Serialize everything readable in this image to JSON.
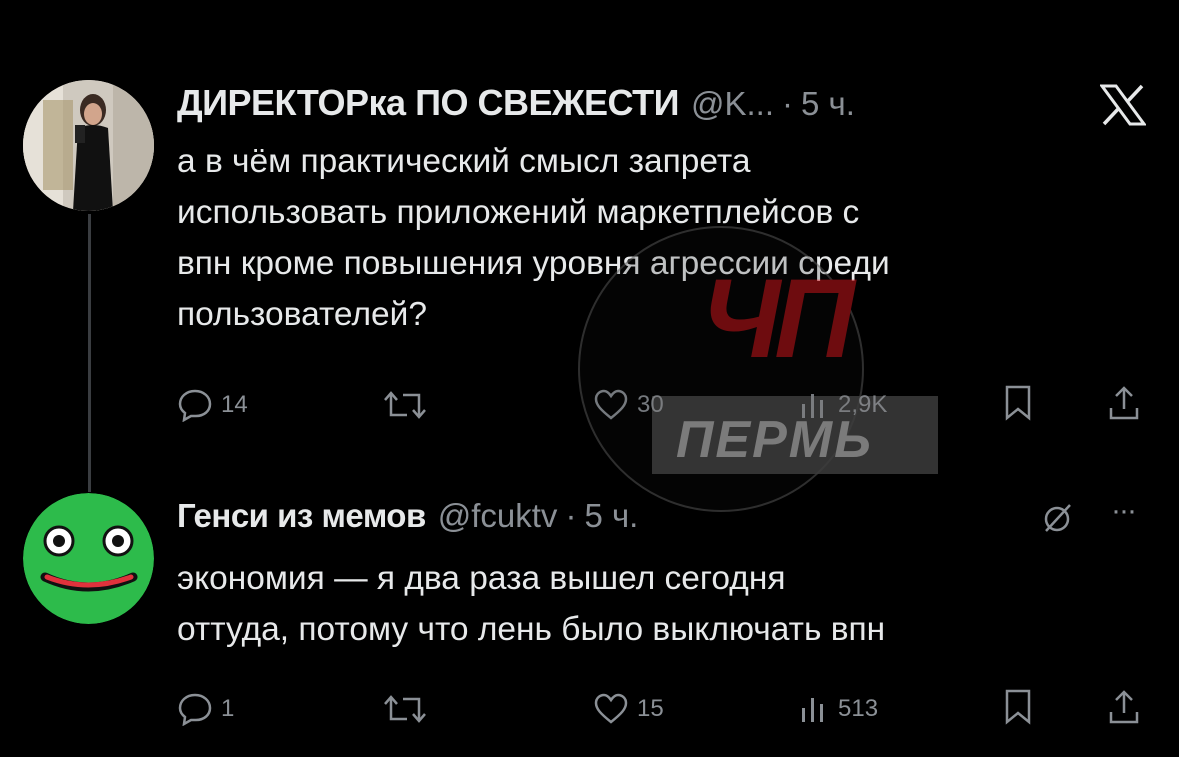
{
  "colors": {
    "background": "#000000",
    "text": "#e7e9ea",
    "muted": "#8b9096",
    "watermark_red": "#c8161d",
    "avatar2_green": "#2dbb4b"
  },
  "tweet1": {
    "author_name": "ДИРЕКТОРка ПО СВЕЖЕСТИ",
    "handle": "@K...",
    "separator": "·",
    "time": "5 ч.",
    "text_lines": [
      "а в чём практический смысл запрета",
      "использовать приложений маркетплейсов с",
      "впн кроме повышения уровня агрессии среди",
      "пользователей?"
    ],
    "actions": {
      "replies": "14",
      "reposts": "",
      "likes": "30",
      "views": "2,9K"
    },
    "icons": [
      "reply-icon",
      "repost-icon",
      "like-icon",
      "views-icon",
      "bookmark-icon",
      "share-icon"
    ]
  },
  "tweet2": {
    "author_name": "Генси из мемов",
    "handle": "@fcuktv",
    "separator": "·",
    "time": "5 ч.",
    "text_lines": [
      "экономия — я два раза вышел сегодня",
      "оттуда, потому что лень было выключать впн"
    ],
    "actions": {
      "replies": "1",
      "reposts": "",
      "likes": "15",
      "views": "513"
    },
    "more": "···"
  },
  "watermark": {
    "top": "ЧП",
    "bottom": "ПЕРМЬ"
  },
  "brand_icon": "x-logo-icon"
}
